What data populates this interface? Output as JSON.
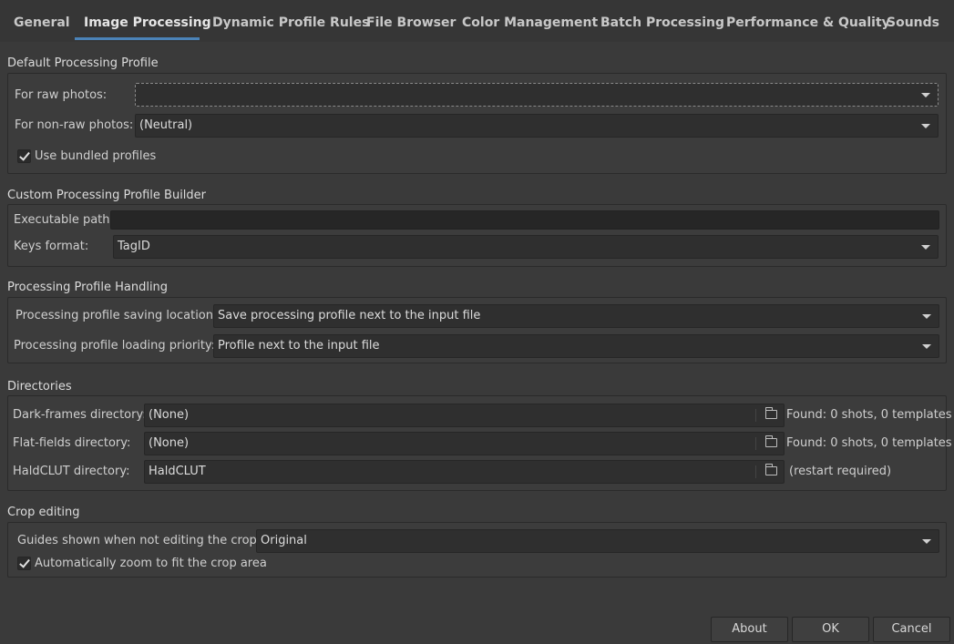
{
  "tabs": [
    {
      "label": "General"
    },
    {
      "label": "Image Processing",
      "active": true
    },
    {
      "label": "Dynamic Profile Rules"
    },
    {
      "label": "File Browser"
    },
    {
      "label": "Color Management"
    },
    {
      "label": "Batch Processing"
    },
    {
      "label": "Performance & Quality"
    },
    {
      "label": "Sounds"
    }
  ],
  "default_profile": {
    "title": "Default Processing Profile",
    "raw_label": "For raw photos:",
    "raw_value": "",
    "nonraw_label": "For non-raw photos:",
    "nonraw_value": "(Neutral)",
    "bundled_label": "Use bundled profiles",
    "bundled_checked": true
  },
  "custom_builder": {
    "title": "Custom Processing Profile Builder",
    "exec_label": "Executable path:",
    "exec_value": "",
    "keys_label": "Keys format:",
    "keys_value": "TagID"
  },
  "profile_handling": {
    "title": "Processing Profile Handling",
    "saving_label": "Processing profile saving location:",
    "saving_value": "Save processing profile next to the input file",
    "loading_label": "Processing profile loading priority:",
    "loading_value": "Profile next to the input file"
  },
  "directories": {
    "title": "Directories",
    "dark_label": "Dark-frames directory:",
    "dark_value": "(None)",
    "dark_status": "Found: 0 shots, 0 templates",
    "flat_label": "Flat-fields directory:",
    "flat_value": "(None)",
    "flat_status": "Found: 0 shots, 0 templates",
    "hald_label": "HaldCLUT directory:",
    "hald_value": "HaldCLUT",
    "hald_status": "(restart required)"
  },
  "crop": {
    "title": "Crop editing",
    "guides_label": "Guides shown when not editing the crop:",
    "guides_value": "Original",
    "autozoom_label": "Automatically zoom to fit the crop area",
    "autozoom_checked": true
  },
  "buttons": {
    "about": "About",
    "ok": "OK",
    "cancel": "Cancel"
  },
  "colors": {
    "background": "#3a3a3a",
    "accent": "#4b83b8"
  }
}
